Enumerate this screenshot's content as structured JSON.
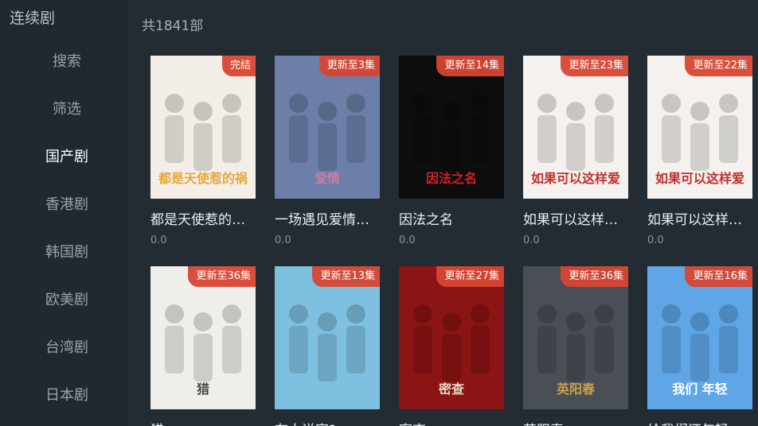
{
  "app_title": "连续剧",
  "count_text": "共1841部",
  "nav": [
    {
      "label": "搜索",
      "active": false
    },
    {
      "label": "筛选",
      "active": false
    },
    {
      "label": "国产剧",
      "active": true
    },
    {
      "label": "香港剧",
      "active": false
    },
    {
      "label": "韩国剧",
      "active": false
    },
    {
      "label": "欧美剧",
      "active": false
    },
    {
      "label": "台湾剧",
      "active": false
    },
    {
      "label": "日本剧",
      "active": false
    }
  ],
  "items": [
    {
      "title": "都是天使惹的…",
      "rating": "0.0",
      "badge": "完结",
      "poster_color": "#f3efe8",
      "poster_accent": "#e9a63a",
      "poster_text": "都是天使惹的祸"
    },
    {
      "title": "一场遇见爱情…",
      "rating": "0.0",
      "badge": "更新至3集",
      "poster_color": "#6b7fa8",
      "poster_accent": "#c97ea0",
      "poster_text": "爱情"
    },
    {
      "title": "因法之名",
      "rating": "0.0",
      "badge": "更新至14集",
      "poster_color": "#0d0d0d",
      "poster_accent": "#d2201f",
      "poster_text": "因法之名"
    },
    {
      "title": "如果可以这样…",
      "rating": "0.0",
      "badge": "更新至23集",
      "poster_color": "#f4f1ee",
      "poster_accent": "#c2302a",
      "poster_text": "如果可以这样爱"
    },
    {
      "title": "如果可以这样…",
      "rating": "0.0",
      "badge": "更新至22集",
      "poster_color": "#f4f1ee",
      "poster_accent": "#c2302a",
      "poster_text": "如果可以这样爱"
    },
    {
      "title": "猎...",
      "rating": "",
      "badge": "更新至36集",
      "poster_color": "#eeeeea",
      "poster_accent": "#444444",
      "poster_text": "猎"
    },
    {
      "title": "有人说家?",
      "rating": "",
      "badge": "更新至13集",
      "poster_color": "#7ec0e0",
      "poster_accent": "#e0b23a",
      "poster_text": ""
    },
    {
      "title": "密查",
      "rating": "",
      "badge": "更新至27集",
      "poster_color": "#8b1414",
      "poster_accent": "#e5d8c0",
      "poster_text": "密查"
    },
    {
      "title": "英阳春",
      "rating": "",
      "badge": "更新至36集",
      "poster_color": "#4a4e56",
      "poster_accent": "#c9a048",
      "poster_text": "英阳春"
    },
    {
      "title": "给我们还年轻",
      "rating": "",
      "badge": "更新至16集",
      "poster_color": "#5ea6e6",
      "poster_accent": "#ffffff",
      "poster_text": "我们 年轻"
    }
  ]
}
